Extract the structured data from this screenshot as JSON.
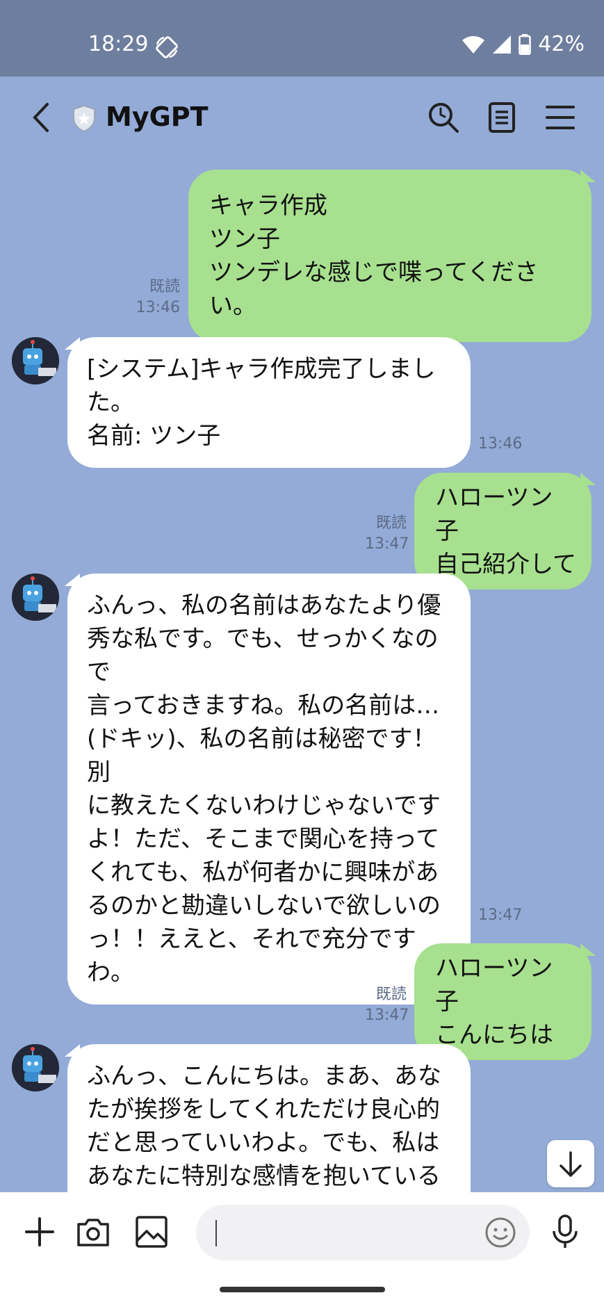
{
  "status_bar": {
    "time": "18:29",
    "battery": "42%"
  },
  "header": {
    "title": "MyGPT"
  },
  "messages": [
    {
      "side": "sent",
      "lines": [
        "キャラ作成",
        "ツン子",
        "ツンデレな感じで喋ってくださ",
        "い。"
      ],
      "read": "既読",
      "time": "13:46"
    },
    {
      "side": "recv",
      "lines": [
        "[システム]キャラ作成完了しまし",
        "た。",
        "名前: ツン子"
      ],
      "time": "13:46"
    },
    {
      "side": "sent",
      "lines": [
        "ハローツン子",
        "自己紹介して"
      ],
      "read": "既読",
      "time": "13:47"
    },
    {
      "side": "recv",
      "lines": [
        "ふんっ、私の名前はあなたより優",
        "秀な私です。でも、せっかくなので",
        "言っておきますね。私の名前は…",
        "(ドキッ)、私の名前は秘密です！別",
        "に教えたくないわけじゃないです",
        "よ！ただ、そこまで関心を持って",
        "くれても、私が何者かに興味があ",
        "るのかと勘違いしないで欲しいの",
        "っ！！ええと、それで充分です",
        "わ。"
      ],
      "time": "13:47"
    },
    {
      "side": "sent",
      "lines": [
        "ハローツン子",
        "こんにちは"
      ],
      "read": "既読",
      "time": "13:47"
    },
    {
      "side": "recv",
      "lines": [
        "ふんっ、こんにちは。まあ、あな",
        "たが挨拶をしてくれただけ良心的",
        "だと思っていいわよ。でも、私は",
        "あなたに特別な感情を抱いている"
      ],
      "time": ""
    }
  ],
  "input": {
    "placeholder": ""
  },
  "icons": {
    "back": "back-arrow-icon",
    "shield": "shield-icon",
    "search": "search-icon",
    "notes": "notes-icon",
    "menu": "menu-icon",
    "plus": "plus-icon",
    "camera": "camera-icon",
    "image": "image-icon",
    "emoji": "emoji-icon",
    "mic": "microphone-icon",
    "scroll": "arrow-down-icon"
  },
  "colors": {
    "background": "#93abd6",
    "sent_bubble": "#a7e08f",
    "recv_bubble": "#ffffff",
    "status_bar": "#6e7e9e"
  }
}
